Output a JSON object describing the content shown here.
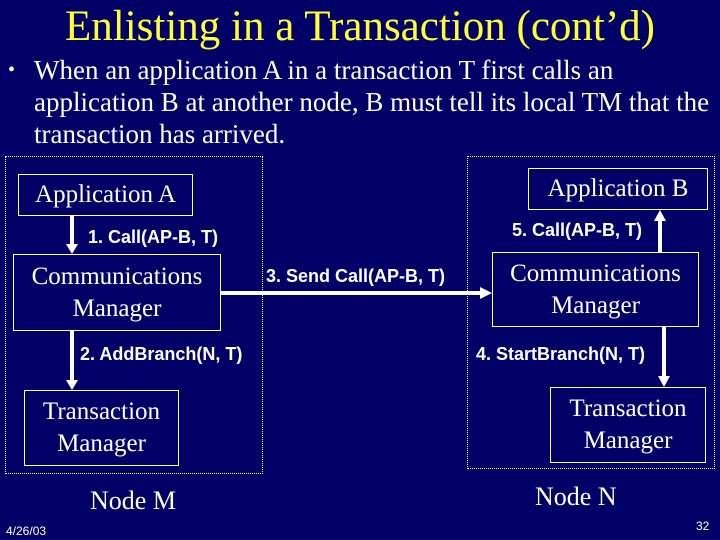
{
  "slide": {
    "title": "Enlisting in a Transaction (cont’d)",
    "bullet": {
      "marker": "•",
      "text": "When an application A in a transaction T first calls an application B at another node, B must tell its local TM that the transaction has arrived."
    },
    "date": "4/26/03",
    "page_number": "32",
    "colors": {
      "background": "#000066",
      "title": "#ffff33",
      "text": "#ffffff"
    }
  },
  "diagram": {
    "nodes": [
      {
        "name": "Node M",
        "label": "Node M",
        "components": {
          "application": "Application A",
          "comm_manager": "Communications\nManager",
          "transaction_manager": "Transaction\nManager"
        }
      },
      {
        "name": "Node N",
        "label": "Node N",
        "components": {
          "application": "Application B",
          "comm_manager": "Communications\nManager",
          "transaction_manager": "Transaction\nManager"
        }
      }
    ],
    "steps": [
      {
        "label": "1. Call(AP-B, T)",
        "from": "Application A",
        "to": "Communications Manager (Node M)"
      },
      {
        "label": "2. AddBranch(N, T)",
        "from": "Communications Manager (Node M)",
        "to": "Transaction Manager (Node M)"
      },
      {
        "label": "3. Send Call(AP-B, T)",
        "from": "Communications Manager (Node M)",
        "to": "Communications Manager (Node N)"
      },
      {
        "label": "4. StartBranch(N, T)",
        "from": "Communications Manager (Node N)",
        "to": "Transaction Manager (Node N)"
      },
      {
        "label": "5. Call(AP-B, T)",
        "from": "Communications Manager (Node N)",
        "to": "Application B"
      }
    ]
  }
}
